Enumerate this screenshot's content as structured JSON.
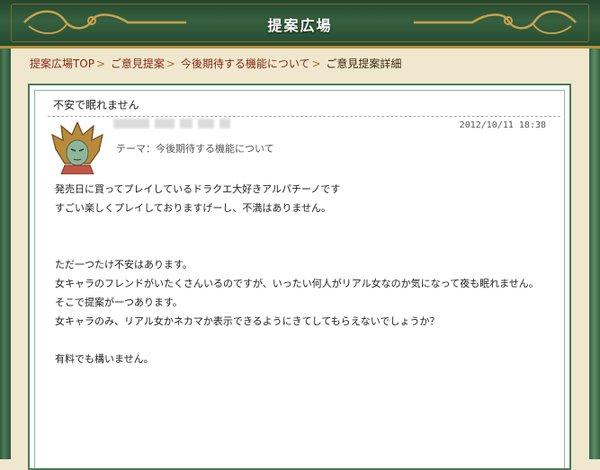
{
  "header": {
    "title": "提案広場"
  },
  "breadcrumb": {
    "items": [
      "提案広場TOP",
      "ご意見提案",
      "今後期待する機能について"
    ],
    "separator": ">",
    "current": "ご意見提案詳細"
  },
  "post": {
    "title": "不安で眠れません",
    "date": "2012/10/11 18:38",
    "theme": "テーマ：今後期待する機能について",
    "lines": [
      "発売日に買ってプレイしているドラクエ大好きアルパチーノです",
      "すごい楽しくプレイしておりますげーし、不満はありません。",
      "",
      "",
      "ただ一つたけ不安はあります。",
      "女キャラのフレンドがいたくさんいるのですが、いったい何人がリアル女なのか気になって夜も眠れません。",
      "そこで提案が一つあります。",
      "女キャラのみ、リアル女かネカマか表示できるようにきてしてもらえないでしょうか？",
      "",
      "有料でも構いません。"
    ]
  },
  "colors": {
    "frame": "#36603f",
    "accent": "#b98e3c",
    "link": "#8a2a12"
  }
}
